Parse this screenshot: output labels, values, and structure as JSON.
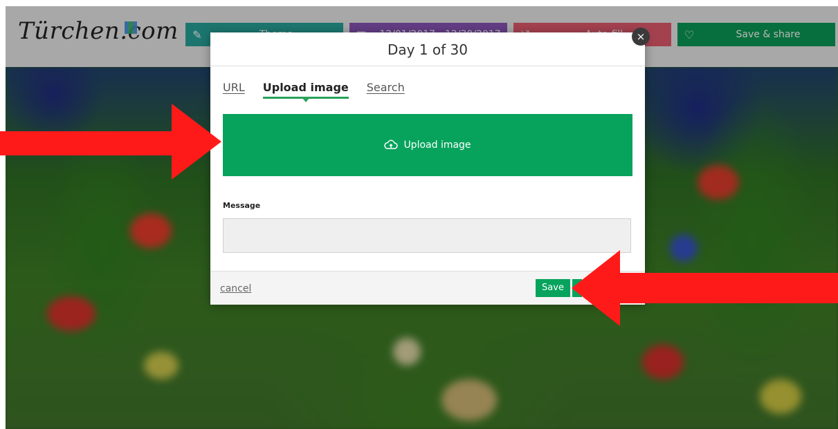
{
  "header": {
    "logo": "Türchen.com",
    "buttons": [
      {
        "icon": "pencil-icon",
        "label": "Theme",
        "color": "#28a49a"
      },
      {
        "icon": "calendar-icon",
        "label": "12/01/2017 - 12/30/2017",
        "color": "#8a55b8"
      },
      {
        "icon": "shuffle-icon",
        "label": "Auto-fill",
        "color": "#e35a6e"
      },
      {
        "icon": "heart-icon",
        "label": "Save & share",
        "color": "#0a9a55"
      }
    ]
  },
  "modal": {
    "title": "Day 1 of 30",
    "close_label": "×",
    "tabs": [
      {
        "label": "URL",
        "active": false
      },
      {
        "label": "Upload image",
        "active": true
      },
      {
        "label": "Search",
        "active": false
      }
    ],
    "upload_label": "Upload image",
    "upload_icon": "cloud-upload-icon",
    "message_label": "Message",
    "message_value": "",
    "cancel_label": "cancel",
    "save_label": "Save"
  },
  "colors": {
    "accent": "#07a35d",
    "arrow": "#ff1a1a"
  }
}
